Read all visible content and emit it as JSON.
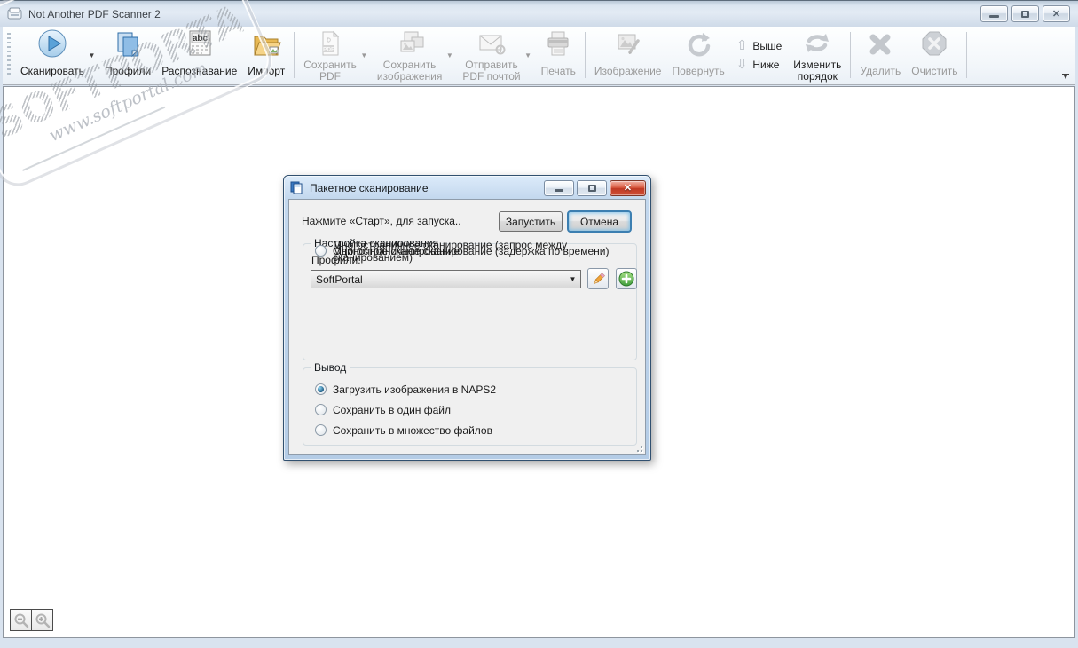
{
  "window": {
    "title": "Not Another PDF Scanner 2"
  },
  "toolbar": {
    "scan": {
      "label": "Сканировать"
    },
    "profiles": {
      "label": "Профили"
    },
    "ocr": {
      "label": "Распознавание"
    },
    "import": {
      "label": "Импорт"
    },
    "save_pdf": {
      "label": "Сохранить",
      "label2": "PDF"
    },
    "save_images": {
      "label": "Сохранить",
      "label2": "изображения"
    },
    "email_pdf": {
      "label": "Отправить",
      "label2": "PDF почтой"
    },
    "print": {
      "label": "Печать"
    },
    "image": {
      "label": "Изображение"
    },
    "rotate": {
      "label": "Повернуть"
    },
    "move_up": {
      "label": "Выше"
    },
    "move_down": {
      "label": "Ниже"
    },
    "reorder": {
      "label": "Изменить",
      "label2": "порядок"
    },
    "delete": {
      "label": "Удалить"
    },
    "clear": {
      "label": "Очистить"
    }
  },
  "watermark": {
    "brand": "SOFTPORTAL",
    "trademark": "™",
    "url": "www.softportal.com"
  },
  "dialog": {
    "title": "Пакетное сканирование",
    "status_text": "Нажмите «Старт», для запуска..",
    "start_button": "Запустить",
    "cancel_button": "Отмена",
    "scan_settings": {
      "title": "Настройка сканирования",
      "profiles_label": "Профили:",
      "profile_value": "SoftPortal",
      "options": [
        "Одиночное сканирование",
        "Многостраничное сканирование (запрос между сканированием)",
        "Многостраничное сканирование (задержка по времени)"
      ],
      "selected_index": 0
    },
    "output": {
      "title": "Вывод",
      "options": [
        "Загрузить изображения в NAPS2",
        "Сохранить в один файл",
        "Сохранить в множество файлов"
      ],
      "selected_index": 0
    }
  },
  "colors": {
    "titlebar": "#d7e2ee",
    "dialog_frame": "#b9cfe7",
    "close_button_red": "#c03a24",
    "radio_selected": "#1d5a82",
    "focus_blue": "#3c7fb1"
  }
}
